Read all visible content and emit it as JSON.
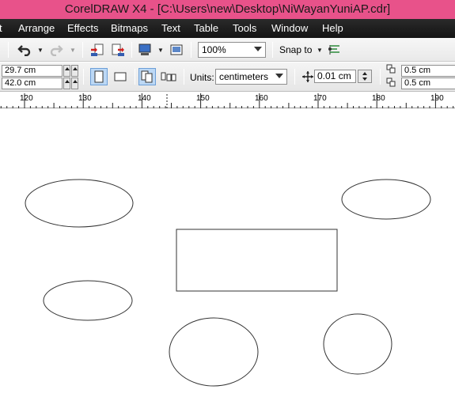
{
  "window": {
    "title": "CorelDRAW X4 - [C:\\Users\\new\\Desktop\\NiWayanYuniAP.cdr]"
  },
  "menu": [
    "t",
    "Arrange",
    "Effects",
    "Bitmaps",
    "Text",
    "Table",
    "Tools",
    "Window",
    "Help"
  ],
  "toolbar": {
    "zoom_value": "100%",
    "snap_label": "Snap to",
    "icons": [
      "undo-icon",
      "redo-icon",
      "import-icon",
      "export-icon",
      "application-launcher-icon",
      "welcome-screen-icon",
      "snap-options-icon"
    ]
  },
  "property_bar": {
    "page_width": "29.7 cm",
    "page_height": "42.0 cm",
    "units_label": "Units:",
    "units_value": "centimeters",
    "nudge_value": "0.01 cm",
    "duplicate_x": "0.5 cm",
    "duplicate_y": "0.5 cm",
    "icons": [
      "portrait-icon",
      "landscape-icon",
      "all-pages-icon",
      "current-page-icon",
      "nudge-icon",
      "duplicate-distance-icon"
    ]
  },
  "ruler": {
    "labels": [
      "120",
      "130",
      "140",
      "150",
      "160",
      "170",
      "180",
      "190"
    ]
  },
  "canvas": {
    "shapes": [
      "ellipse",
      "ellipse",
      "rectangle",
      "ellipse",
      "ellipse",
      "ellipse"
    ]
  },
  "colors": {
    "titlebar": "#e8528a",
    "menubar": "#1c1c1c",
    "toolbar": "#eeeeee",
    "active_button": "#bcd8f5"
  }
}
